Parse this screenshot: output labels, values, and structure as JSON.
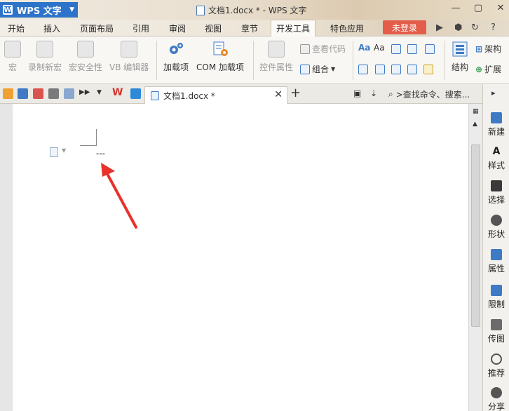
{
  "app": {
    "menu_label": "WPS 文字",
    "logo_letter": "W",
    "window_title": "文档1.docx * - WPS 文字"
  },
  "window_controls": {
    "minimize": "—",
    "restore": "▢",
    "close": "✕"
  },
  "menu_tabs": [
    "开始",
    "插入",
    "页面布局",
    "引用",
    "审阅",
    "视图",
    "章节",
    "开发工具",
    "特色应用"
  ],
  "active_menu_tab": "开发工具",
  "login_label": "未登录",
  "ribbon": {
    "macro": "宏",
    "record_macro": "录制新宏",
    "macro_security": "宏安全性",
    "vb_editor": "VB 编辑器",
    "addins": "加载项",
    "com_addins": "COM 加载项",
    "control_properties": "控件属性",
    "view_code": "查看代码",
    "group": "组合",
    "structure": "结构",
    "frame": "架构",
    "expand": "扩展"
  },
  "doc_tab": {
    "title": "文档1.docx *",
    "close": "✕"
  },
  "new_tab": "+",
  "search_placeholder": ">查找命令、搜索...",
  "document": {
    "text": "---"
  },
  "right_panel": {
    "items": [
      "新建",
      "样式",
      "选择",
      "形状",
      "属性",
      "限制",
      "传图",
      "推荐",
      "分享"
    ]
  },
  "colors": {
    "accent": "#2c73c9",
    "login": "#e35d4a",
    "arrow": "#e8322b"
  }
}
